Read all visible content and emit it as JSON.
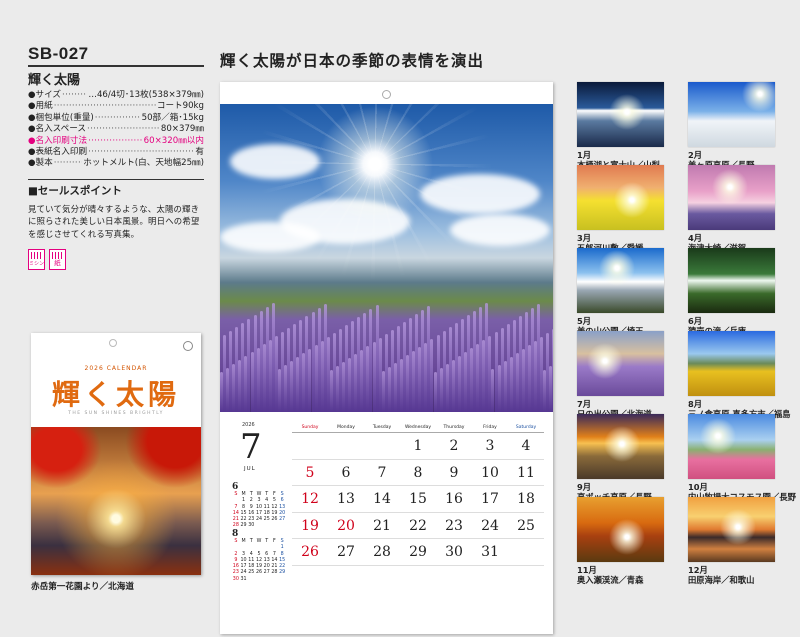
{
  "product": {
    "code": "SB-027",
    "name": "輝く太陽"
  },
  "specs": [
    {
      "label": "●サイズ",
      "value": "…46/4切･13枚(538×379㎜)",
      "highlight": false
    },
    {
      "label": "●用紙",
      "value": "コート90kg",
      "highlight": false
    },
    {
      "label": "●梱包単位(重量)",
      "value": "50部／箱･15kg",
      "highlight": false
    },
    {
      "label": "●名入スペース",
      "value": "80×379㎜",
      "highlight": false
    },
    {
      "label": "●名入印刷寸法",
      "value": "60×320㎜以内",
      "highlight": true
    },
    {
      "label": "●表紙名入印刷",
      "value": "有",
      "highlight": false
    },
    {
      "label": "●製本",
      "value": "ホットメルト(白、天地幅25㎜)",
      "highlight": false
    }
  ],
  "sales": {
    "heading": "■セールスポイント",
    "text": "見ていて気分が晴々するような、太陽の輝きに照らされた美しい日本風景。明日への希望を感じさせてくれる写真集。"
  },
  "badges": [
    "ミシン",
    "紙"
  ],
  "cover": {
    "year_label": "2026 CALENDAR",
    "title": "輝く太陽",
    "subtitle": "THE SUN SHINES BRIGHTLY",
    "caption": "赤岳第一花園より／北海道"
  },
  "headline": "輝く太陽が日本の季節の表情を演出",
  "calendar": {
    "year": "2026",
    "month": "7",
    "month_name": "JUL",
    "weekdays": [
      "Sunday",
      "Monday",
      "Tuesday",
      "Wednesday",
      "Thursday",
      "Friday",
      "Saturday"
    ],
    "days": [
      "",
      "",
      "",
      "1",
      "2",
      "3",
      "4",
      "5",
      "6",
      "7",
      "8",
      "9",
      "10",
      "11",
      "12",
      "13",
      "14",
      "15",
      "16",
      "17",
      "18",
      "19",
      "20",
      "21",
      "22",
      "23",
      "24",
      "25",
      "26",
      "27",
      "28",
      "29",
      "30",
      "31",
      ""
    ],
    "holiday": "20",
    "mini_prev": {
      "month": "6",
      "label": "JUNE",
      "days": [
        "",
        "1",
        "2",
        "3",
        "4",
        "5",
        "6",
        "7",
        "8",
        "9",
        "10",
        "11",
        "12",
        "13",
        "14",
        "15",
        "16",
        "17",
        "18",
        "19",
        "20",
        "21",
        "22",
        "23",
        "24",
        "25",
        "26",
        "27",
        "28",
        "29",
        "30",
        "",
        "",
        "",
        ""
      ]
    },
    "mini_next": {
      "month": "8",
      "label": "AUGUST",
      "days": [
        "",
        "",
        "",
        "",
        "",
        "",
        "1",
        "2",
        "3",
        "4",
        "5",
        "6",
        "7",
        "8",
        "9",
        "10",
        "11",
        "12",
        "13",
        "14",
        "15",
        "16",
        "17",
        "18",
        "19",
        "20",
        "21",
        "22",
        "23",
        "24",
        "25",
        "26",
        "27",
        "28",
        "29",
        "30",
        "31"
      ]
    }
  },
  "months": [
    {
      "month": "1月",
      "location": "本栖湖と富士山／山梨"
    },
    {
      "month": "2月",
      "location": "美ヶ原高原／長野"
    },
    {
      "month": "3月",
      "location": "五郎河川敷／愛媛"
    },
    {
      "month": "4月",
      "location": "海津大崎／滋賀"
    },
    {
      "month": "5月",
      "location": "美の山公園／埼玉"
    },
    {
      "month": "6月",
      "location": "猿壺の滝／兵庫"
    },
    {
      "month": "7月",
      "location": "日の出公園／北海道"
    },
    {
      "month": "8月",
      "location": "三ノ倉高原 喜多方市／福島"
    },
    {
      "month": "9月",
      "location": "高ボッチ高原／長野"
    },
    {
      "month": "10月",
      "location": "内山牧場大コスモス園／長野"
    },
    {
      "month": "11月",
      "location": "奥入瀬渓流／青森"
    },
    {
      "month": "12月",
      "location": "田原海岸／和歌山"
    }
  ]
}
